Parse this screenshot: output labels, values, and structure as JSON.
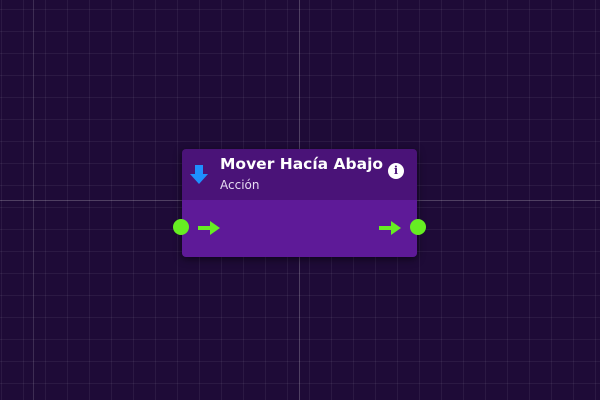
{
  "node": {
    "title": "Mover Hacía Abajo",
    "subtitle": "Acción",
    "icon": "arrow-down-icon",
    "info_icon": "info-icon",
    "colors": {
      "header": "#4a1378",
      "body": "#5e1a98",
      "port": "#66ee22",
      "icon": "#1e90ff"
    }
  },
  "canvas": {
    "background": "#1e0b37"
  }
}
